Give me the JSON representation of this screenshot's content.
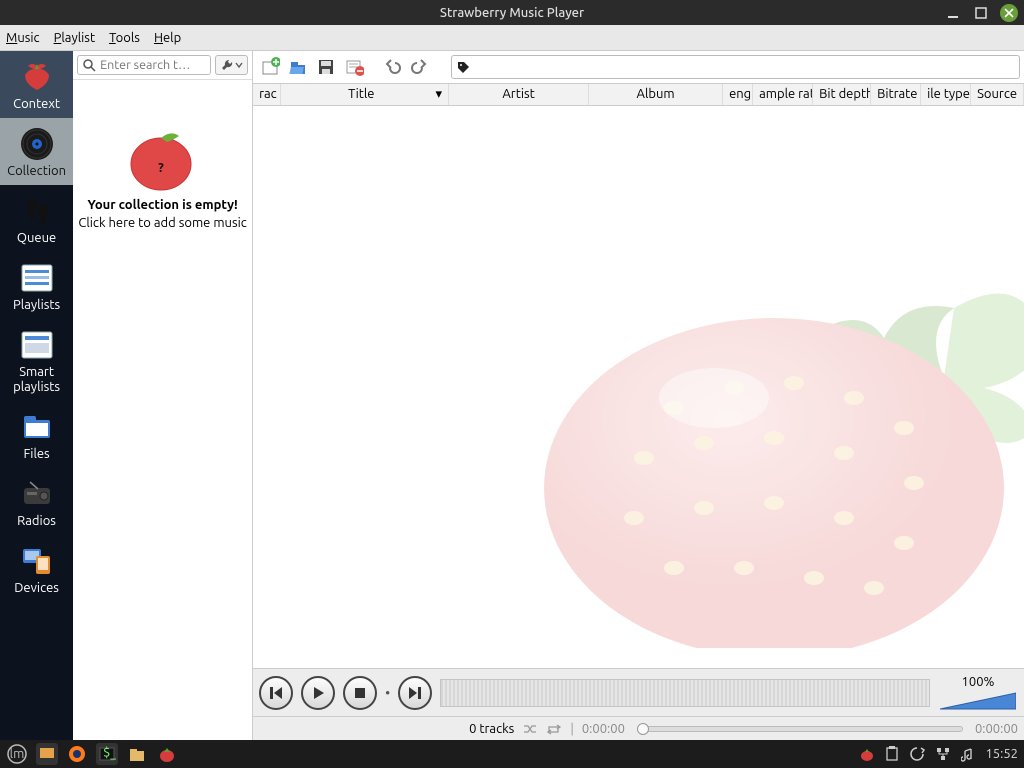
{
  "window": {
    "title": "Strawberry Music Player"
  },
  "menu": {
    "items": [
      "Music",
      "Playlist",
      "Tools",
      "Help"
    ]
  },
  "sidebar": {
    "items": [
      {
        "label": "Context"
      },
      {
        "label": "Collection"
      },
      {
        "label": "Queue"
      },
      {
        "label": "Playlists"
      },
      {
        "label": "Smart playlists"
      },
      {
        "label": "Files"
      },
      {
        "label": "Radios"
      },
      {
        "label": "Devices"
      }
    ]
  },
  "collection": {
    "search_placeholder": "Enter search t…",
    "empty_title": "Your collection is empty!",
    "empty_sub": "Click here to add some music"
  },
  "columns": [
    "rac",
    "Title",
    "Artist",
    "Album",
    "engt",
    "ample rat",
    "Bit depth",
    "Bitrate",
    "ile type",
    "Source"
  ],
  "volume": {
    "label": "100%"
  },
  "status": {
    "tracks": "0 tracks",
    "time_a": "0:00:00",
    "time_b": "0:00:00"
  },
  "clock": "15:52"
}
